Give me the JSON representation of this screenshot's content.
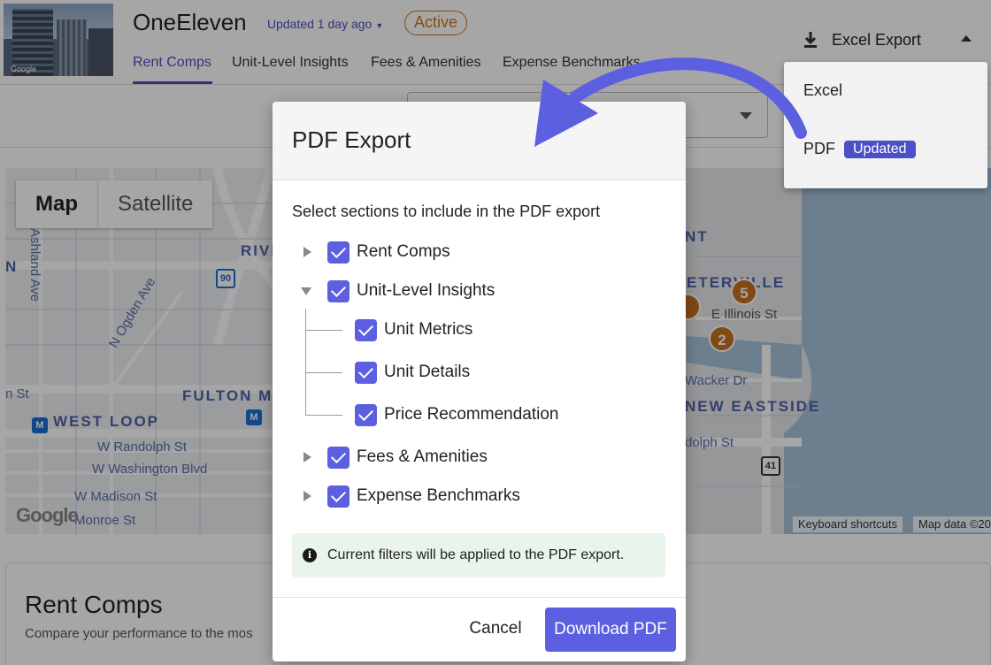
{
  "header": {
    "property_name": "OneEleven",
    "updated_label": "Updated 1 day ago",
    "status_badge": "Active",
    "thumb_credit": "Google",
    "tabs": [
      {
        "label": "Rent Comps"
      },
      {
        "label": "Unit-Level Insights"
      },
      {
        "label": "Fees & Amenities"
      },
      {
        "label": "Expense Benchmarks"
      }
    ],
    "export_button": "Excel Export"
  },
  "export_menu": {
    "items": [
      {
        "label": "Excel"
      },
      {
        "label": "PDF",
        "badge": "Updated"
      }
    ]
  },
  "map": {
    "toggle": {
      "map": "Map",
      "satellite": "Satellite"
    },
    "labels": {
      "river_north": "RIVE",
      "fulton": "FULTON MA",
      "west_loop": "WEST LOOP",
      "streeterville": "ETERVILLE",
      "streeterville_top": "NT",
      "new_eastside": "NEW EASTSIDE",
      "ashland": "Ashland Ave",
      "ogden": "N Ogden Ave",
      "randolph": "W Randolph St",
      "washington": "W Washington Blvd",
      "madison": "W Madison St",
      "monroe": "Monroe St",
      "illinois": "E Illinois St",
      "wacker": "Wacker Dr",
      "randolph_e": "dolph St",
      "n_fragment": "N",
      "st_fragment": "n St",
      "i90": "90",
      "us41": "41"
    },
    "markers": [
      "5",
      "2"
    ],
    "metro_label": "M",
    "keyboard_shortcuts": "Keyboard shortcuts",
    "map_data": "Map data ©20",
    "google": "Google"
  },
  "rent_comps_card": {
    "title": "Rent Comps",
    "subtitle": "Compare your performance to the mos"
  },
  "modal": {
    "title": "PDF Export",
    "description": "Select sections to include in the PDF export",
    "sections": [
      {
        "label": "Rent Comps",
        "checked": true,
        "expanded": false
      },
      {
        "label": "Unit-Level Insights",
        "checked": true,
        "expanded": true,
        "children": [
          {
            "label": "Unit Metrics",
            "checked": true
          },
          {
            "label": "Unit Details",
            "checked": true
          },
          {
            "label": "Price Recommendation",
            "checked": true
          }
        ]
      },
      {
        "label": "Fees & Amenities",
        "checked": true,
        "expanded": false
      },
      {
        "label": "Expense Benchmarks",
        "checked": true,
        "expanded": false
      }
    ],
    "info_text": "Current filters will be applied to the PDF export.",
    "cancel_label": "Cancel",
    "download_label": "Download PDF"
  },
  "colors": {
    "accent": "#5b5fe0",
    "link": "#4b4fc8",
    "active_badge": "#d2731a",
    "marker": "#c7701e",
    "info_bg": "#e9f5ea",
    "arrow": "#5b5fe0"
  },
  "icons": {
    "download": "download-icon",
    "info": "info-icon",
    "expand_right": "chevron-right-icon",
    "expand_down": "chevron-down-icon",
    "checkbox": "checkbox-checked-icon",
    "arrow": "curved-arrow-icon"
  }
}
